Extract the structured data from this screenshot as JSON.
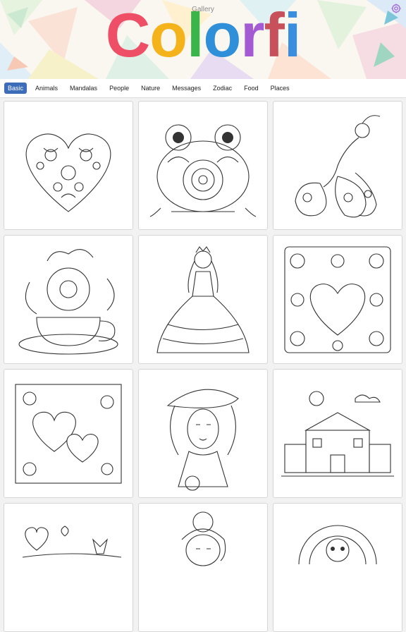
{
  "header": {
    "title": "Gallery",
    "logo": {
      "text": "Colorfi",
      "letters": [
        {
          "char": "C",
          "color": "#ef4f66"
        },
        {
          "char": "o",
          "color": "#f5b31b"
        },
        {
          "char": "l",
          "color": "#39b54a"
        },
        {
          "char": "o",
          "color": "#2f8fd8"
        },
        {
          "char": "r",
          "color": "#a35ad3"
        },
        {
          "char": "f",
          "color": "#c8505a"
        },
        {
          "char": "i",
          "color": "#3b8de0"
        }
      ]
    },
    "settings_icon": "gear-icon"
  },
  "tabs": [
    {
      "label": "Basic",
      "active": true
    },
    {
      "label": "Animals",
      "active": false
    },
    {
      "label": "Mandalas",
      "active": false
    },
    {
      "label": "People",
      "active": false
    },
    {
      "label": "Nature",
      "active": false
    },
    {
      "label": "Messages",
      "active": false
    },
    {
      "label": "Zodiac",
      "active": false
    },
    {
      "label": "Food",
      "active": false
    },
    {
      "label": "Places",
      "active": false
    }
  ],
  "gallery": {
    "items": [
      {
        "subject": "floral-heart"
      },
      {
        "subject": "frog"
      },
      {
        "subject": "peacock"
      },
      {
        "subject": "teacup-bouquet"
      },
      {
        "subject": "princess"
      },
      {
        "subject": "floral-frame-heart"
      },
      {
        "subject": "two-hearts-floral"
      },
      {
        "subject": "lady-with-hat"
      },
      {
        "subject": "school-building"
      },
      {
        "subject": "hearts-butterflies"
      },
      {
        "subject": "girl-portrait"
      },
      {
        "subject": "mandala-face"
      }
    ]
  },
  "colors": {
    "accent": "#3d6db8",
    "tab_bar": "#ffffff",
    "background": "#f2f2f2"
  }
}
